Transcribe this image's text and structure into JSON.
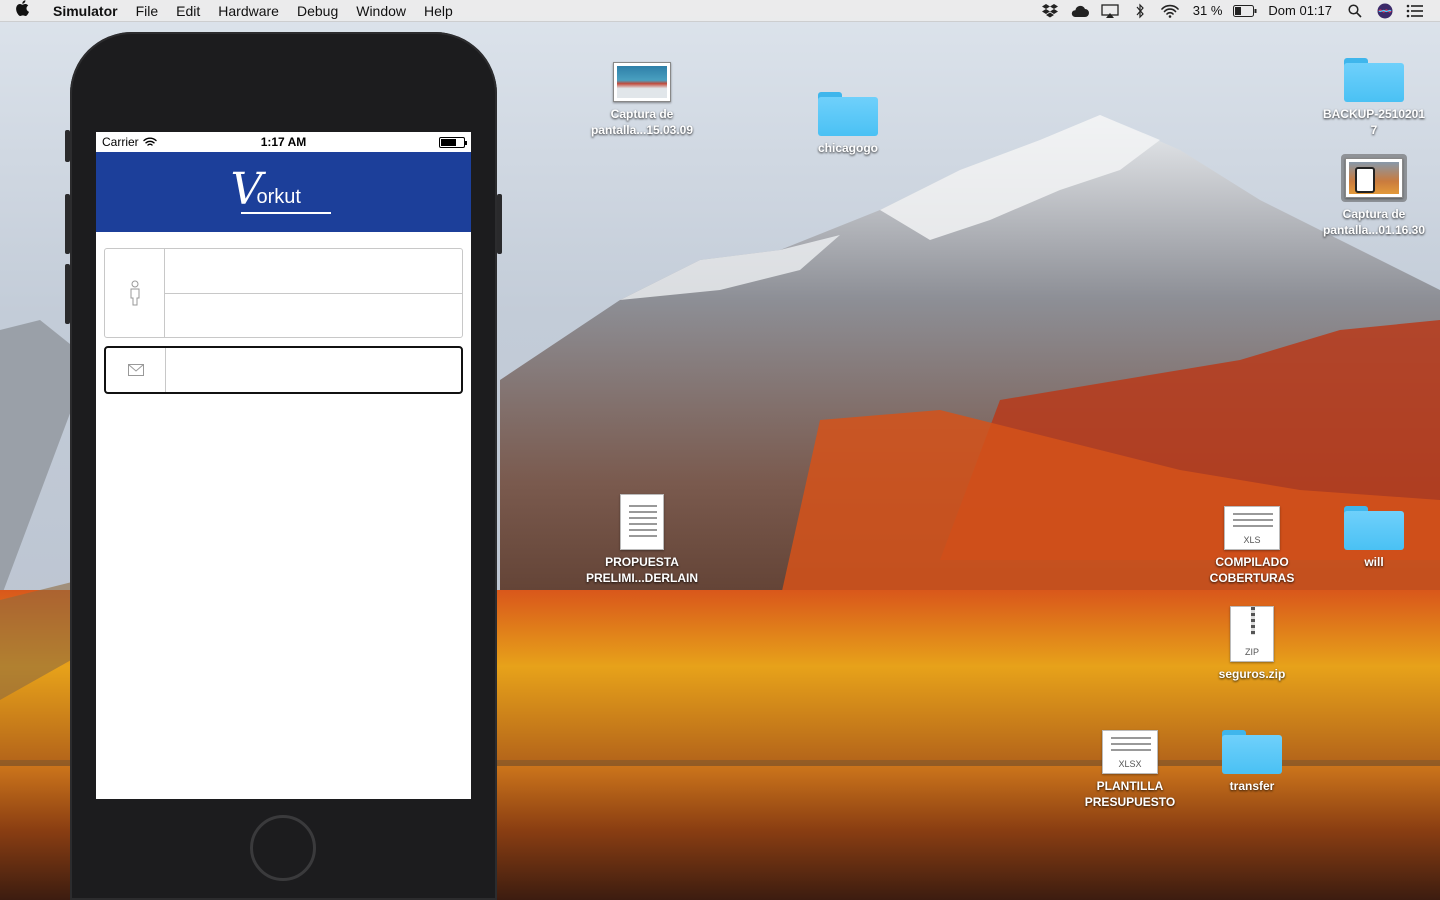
{
  "menubar": {
    "apple_icon": "apple-icon",
    "app_name": "Simulator",
    "menus": [
      "File",
      "Edit",
      "Hardware",
      "Debug",
      "Window",
      "Help"
    ],
    "battery_percent": "31 %",
    "clock": "Dom 01:17"
  },
  "desktop": {
    "icons": [
      {
        "label": "Captura de\npantalla...15.03.09",
        "kind": "screenshot"
      },
      {
        "label": "chicagogo",
        "kind": "folder"
      },
      {
        "label": "BACKUP-2510201\n7",
        "kind": "folder"
      },
      {
        "label": "Captura de\npantalla...01.16.30",
        "kind": "screenshot",
        "selected": true
      },
      {
        "label": "PROPUESTA\nPRELIMI...DERLAIN",
        "kind": "document"
      },
      {
        "label": "COMPILADO\nCOBERTURAS",
        "kind": "xls",
        "badge": "XLS"
      },
      {
        "label": "will",
        "kind": "folder"
      },
      {
        "label": "seguros.zip",
        "kind": "zip",
        "badge": "ZIP"
      },
      {
        "label": "PLANTILLA\nPRESUPUESTO",
        "kind": "xlsx",
        "badge": "XLSX"
      },
      {
        "label": "transfer",
        "kind": "folder"
      }
    ]
  },
  "simulator": {
    "status": {
      "carrier": "Carrier",
      "time": "1:17 AM"
    },
    "header": {
      "brand_w": "V",
      "brand_rest": "orkut",
      "bg": "#1c3f9a"
    },
    "form": {
      "user_field_1": {
        "value": "",
        "placeholder": ""
      },
      "user_field_2": {
        "value": "",
        "placeholder": ""
      },
      "email_field": {
        "value": "",
        "placeholder": ""
      }
    }
  },
  "colors": {
    "folder": "#4ac1f4",
    "header_blue": "#1c3f9a",
    "phone_frame": "#1c1c1e"
  }
}
